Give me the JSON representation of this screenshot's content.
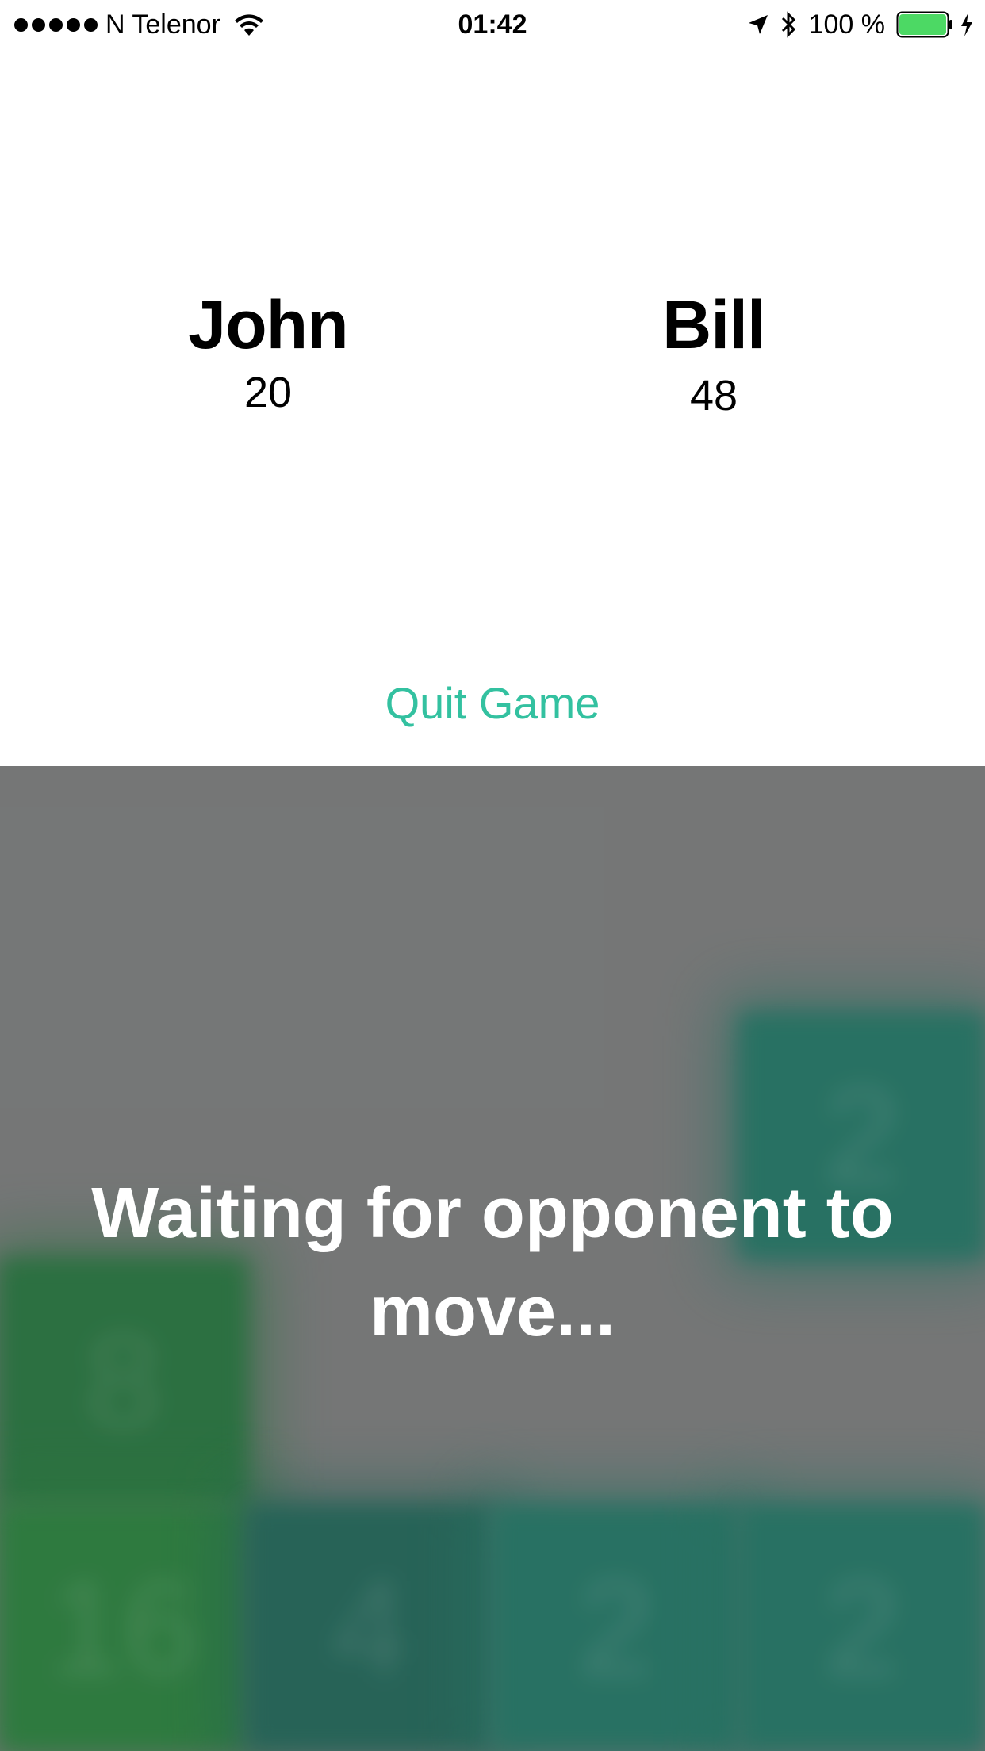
{
  "status_bar": {
    "carrier": "N Telenor",
    "time": "01:42",
    "battery": "100 %"
  },
  "players": [
    {
      "name": "John",
      "score": "20"
    },
    {
      "name": "Bill",
      "score": "48"
    }
  ],
  "actions": {
    "quit_label": "Quit Game"
  },
  "board": {
    "status_message": "Waiting for opponent to move...",
    "tiles": [
      {
        "value": "2",
        "row": 1,
        "col": 3,
        "color": "#17705e"
      },
      {
        "value": "8",
        "row": 2,
        "col": 0,
        "color": "#1b6e35"
      },
      {
        "value": "16",
        "row": 3,
        "col": 0,
        "color": "#1e7a33"
      },
      {
        "value": "4",
        "row": 3,
        "col": 1,
        "color": "#155f50"
      },
      {
        "value": "2",
        "row": 3,
        "col": 2,
        "color": "#17705e"
      },
      {
        "value": "2",
        "row": 3,
        "col": 3,
        "color": "#17705e"
      }
    ]
  },
  "colors": {
    "accent": "#33c1a0",
    "board_background": "#747676",
    "battery_green": "#4cd964"
  },
  "icons": [
    "signal-dots-icon",
    "wifi-icon",
    "location-arrow-icon",
    "bluetooth-icon",
    "battery-icon",
    "charging-bolt-icon"
  ]
}
